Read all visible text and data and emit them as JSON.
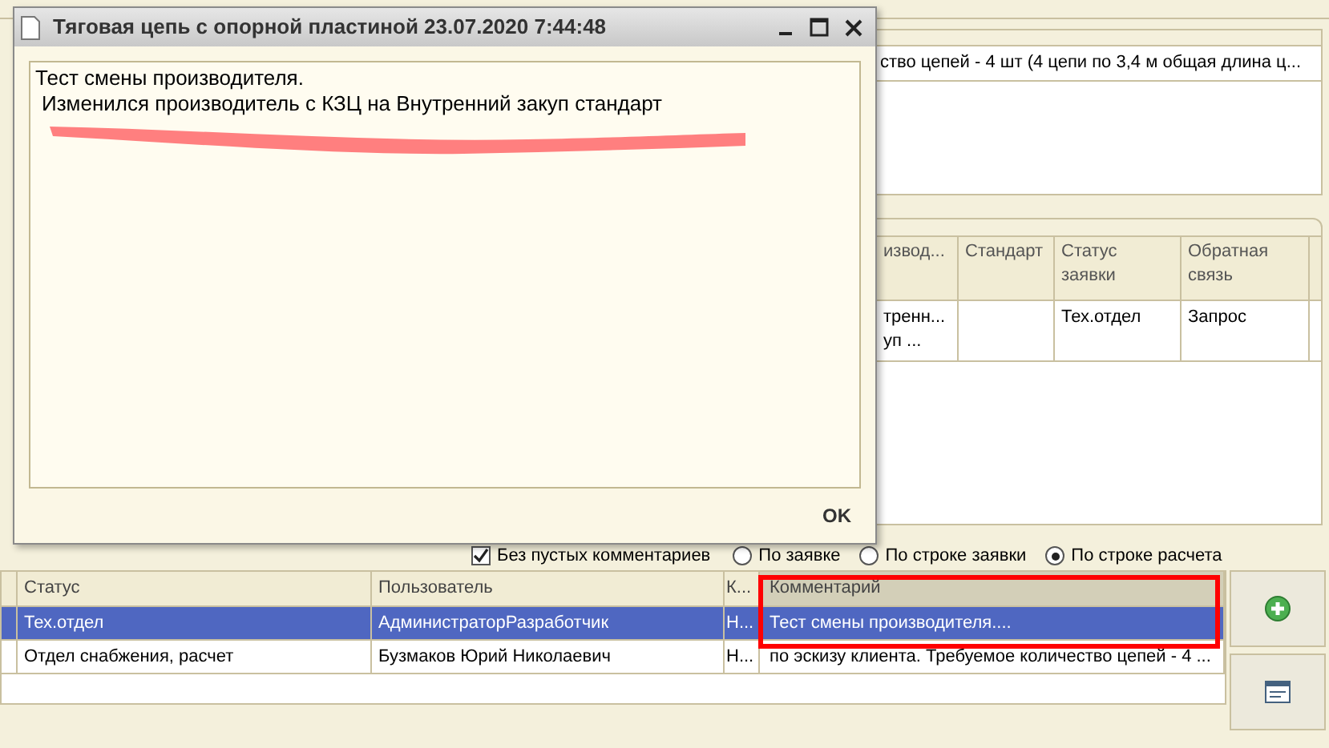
{
  "dialog": {
    "title": "Тяговая цепь с опорной пластиной 23.07.2020 7:44:48",
    "lines": [
      "Тест смены производителя.",
      "Изменился производитель с КЗЦ на Внутренний закуп стандарт"
    ],
    "ok_button": "OK"
  },
  "top_panel": {
    "cell": "ство цепей - 4 шт (4 цепи по 3,4 м общая длина ц..."
  },
  "request_table": {
    "columns": [
      "извод...",
      "Стандарт",
      "Статус заявки",
      "Обратная связь"
    ],
    "rows": [
      {
        "cells": [
          [
            "тренн...",
            "уп ..."
          ],
          null,
          [
            "Тех.отдел"
          ],
          [
            "Запрос"
          ]
        ]
      }
    ]
  },
  "filters": {
    "checkbox": {
      "label": "Без пустых комментариев",
      "checked": true
    },
    "radios": [
      {
        "label": "По заявке",
        "selected": false
      },
      {
        "label": "По строке заявки",
        "selected": false
      },
      {
        "label": "По строке расчета",
        "selected": true
      }
    ]
  },
  "comments_table": {
    "columns": [
      "Статус",
      "Пользователь",
      "К...",
      "Комментарий"
    ],
    "rows": [
      {
        "selected": true,
        "cells": [
          "Тех.отдел",
          "АдминистраторРазработчик",
          "Н...",
          "Тест смены производителя...."
        ]
      },
      {
        "selected": false,
        "cells": [
          "Отдел снабжения, расчет",
          "Бузмаков Юрий Николаевич",
          "Н...",
          "по эскизу клиента. Требуемое количество цепей - 4 ..."
        ]
      }
    ]
  }
}
